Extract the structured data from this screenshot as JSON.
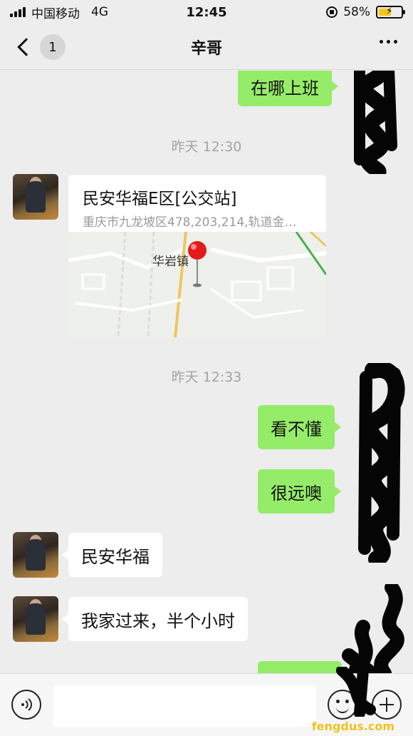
{
  "status_bar": {
    "carrier": "中国移动",
    "network": "4G",
    "time": "12:45",
    "battery_percent": "58%",
    "battery_level": 0.58,
    "battery_color": "#f5c518"
  },
  "nav": {
    "unread_count": "1",
    "title": "辛哥",
    "back_icon": "chevron-left-icon",
    "more_icon": "more-dots-icon"
  },
  "messages": [
    {
      "type": "text",
      "direction": "out",
      "text": "在哪上班"
    },
    {
      "type": "timestamp",
      "text": "昨天 12:30"
    },
    {
      "type": "location",
      "direction": "in",
      "title": "民安华福E区[公交站]",
      "address": "重庆市九龙坡区478,203,214,轨道金…",
      "map_label": "华岩镇"
    },
    {
      "type": "timestamp",
      "text": "昨天 12:33"
    },
    {
      "type": "text",
      "direction": "out",
      "text": "看不懂"
    },
    {
      "type": "text",
      "direction": "out",
      "text": "很远噢"
    },
    {
      "type": "text",
      "direction": "in",
      "text": "民安华福"
    },
    {
      "type": "text",
      "direction": "in",
      "text": "我家过来，半个小时"
    },
    {
      "type": "text",
      "direction": "out",
      "text": ""
    }
  ],
  "input_bar": {
    "voice_icon": "voice-icon",
    "input_value": "",
    "emoji_icon": "emoji-icon",
    "plus_icon": "plus-icon"
  },
  "colors": {
    "outgoing_bubble": "#95ec69",
    "incoming_bubble": "#ffffff",
    "background": "#ededed",
    "timestamp": "#a3a3a3"
  },
  "watermark": "fengdus.com"
}
